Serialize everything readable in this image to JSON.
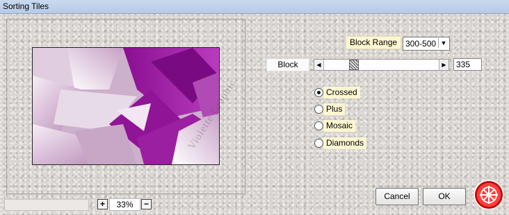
{
  "window": {
    "title": "Sorting Tiles"
  },
  "preview": {
    "watermark": "Violette Graphic"
  },
  "zoom": {
    "plus_label": "+",
    "minus_label": "−",
    "value": "33%"
  },
  "block_range": {
    "label": "Block Range",
    "selected": "300-500"
  },
  "block": {
    "label": "Block",
    "value": "335",
    "level": 0.245
  },
  "modes": [
    {
      "label": "Crossed",
      "checked": true
    },
    {
      "label": "Plus",
      "checked": false
    },
    {
      "label": "Mosaic",
      "checked": false
    },
    {
      "label": "Diamonds",
      "checked": false
    }
  ],
  "buttons": {
    "cancel": "Cancel",
    "ok": "OK"
  },
  "icons": [
    "left-arrow-icon",
    "right-arrow-icon",
    "dropdown-arrow-icon",
    "logo-icon"
  ],
  "colors": {
    "accent": "#9a1aa0",
    "label_bg": "#fdf6d2"
  }
}
